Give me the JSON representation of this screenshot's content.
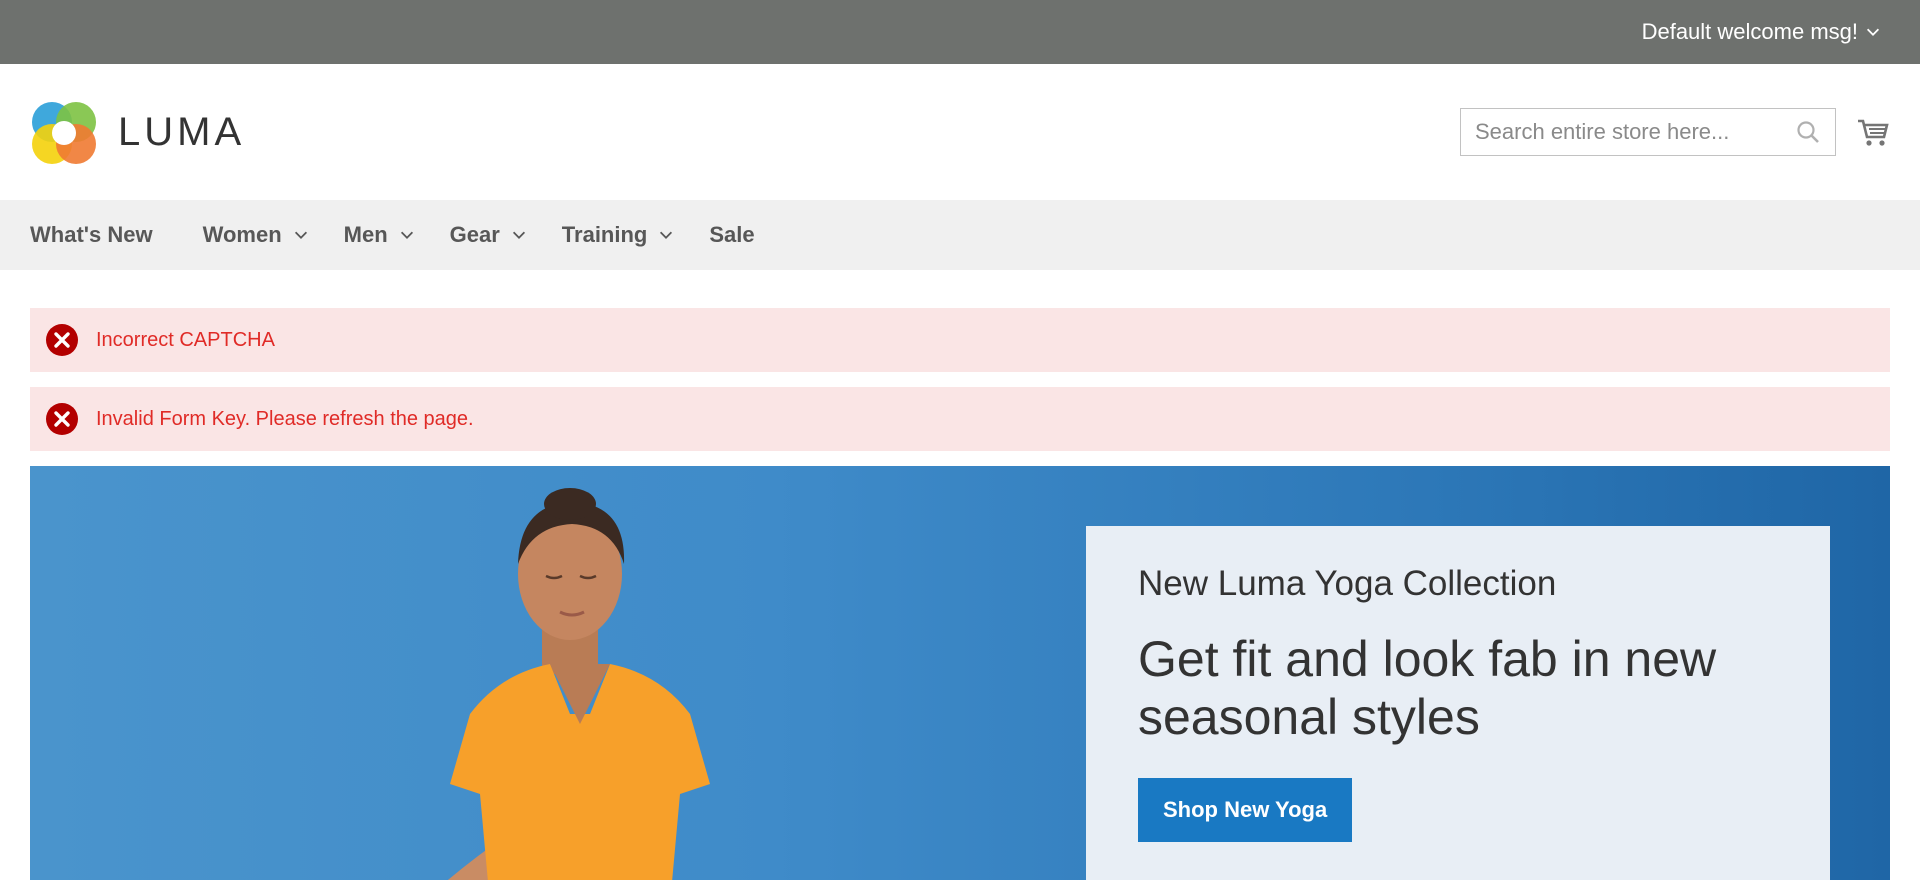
{
  "topbar": {
    "welcome_text": "Default welcome msg!",
    "icon": "chevron-down-icon"
  },
  "header": {
    "logo_text": "LUMA",
    "search": {
      "placeholder": "Search entire store here...",
      "value": ""
    },
    "icons": [
      "search-icon",
      "cart-icon"
    ]
  },
  "nav": {
    "items": [
      {
        "label": "What's New",
        "has_dropdown": false
      },
      {
        "label": "Women",
        "has_dropdown": true
      },
      {
        "label": "Men",
        "has_dropdown": true
      },
      {
        "label": "Gear",
        "has_dropdown": true
      },
      {
        "label": "Training",
        "has_dropdown": true
      },
      {
        "label": "Sale",
        "has_dropdown": false
      }
    ]
  },
  "messages": [
    {
      "text": "Incorrect CAPTCHA",
      "type": "error"
    },
    {
      "text": "Invalid Form Key. Please refresh the page.",
      "type": "error"
    }
  ],
  "hero": {
    "subtitle": "New Luma Yoga Collection",
    "title": "Get fit and look fab in new seasonal styles",
    "button_label": "Shop New Yoga"
  },
  "colors": {
    "topbar_bg": "#6e716e",
    "nav_bg": "#f0f0f0",
    "error_bg": "#fae5e5",
    "error_text": "#e02b27",
    "error_icon": "#b30000",
    "accent": "#1979c3"
  }
}
